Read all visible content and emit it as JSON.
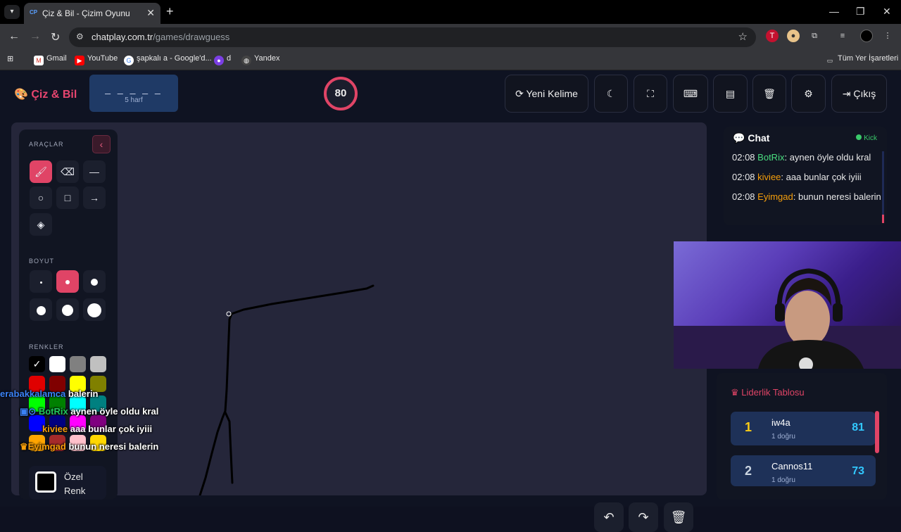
{
  "browser": {
    "tab_title": "Çiz & Bil - Çizim Oyunu",
    "favicon": "CP",
    "url_host": "chatplay.com.tr",
    "url_path": "/games/drawguess",
    "bookmarks": [
      "Gmail",
      "YouTube",
      "şapkalı a - Google'd...",
      "d",
      "Yandex"
    ],
    "all_bookmarks": "Tüm Yer İşaretleri"
  },
  "header": {
    "logo": "Çiz & Bil",
    "word_blanks": "_ _ _ _ _",
    "word_hint": "5 harf",
    "timer": "80",
    "new_word": "Yeni Kelime",
    "exit": "Çıkış"
  },
  "tools": {
    "section_tools": "ARAÇLAR",
    "section_size": "BOYUT",
    "section_colors": "RENKLER",
    "custom_color": "Özel Renk",
    "colors": [
      "#000000",
      "#ffffff",
      "#808080",
      "#c0c0c0",
      "#e00000",
      "#800000",
      "#ffff00",
      "#808000",
      "#00ff00",
      "#008000",
      "#00ffff",
      "#008080",
      "#0000ff",
      "#000080",
      "#ff00ff",
      "#800080",
      "#ffa500",
      "#a52a2a",
      "#ffc0cb",
      "#ffd700"
    ]
  },
  "overlay_chat": [
    {
      "user": "erabakkalamca",
      "text": "balerin",
      "color": "#3b82f6"
    },
    {
      "user": "BotRix",
      "text": "aynen öyle oldu kral",
      "color": "#22c55e"
    },
    {
      "user": "kiviee",
      "text": "aaa bunlar çok iyiii",
      "color": "#f59e0b"
    },
    {
      "user": "Eyimgad",
      "text": "bunun neresi balerin",
      "color": "#f59e0b"
    }
  ],
  "chat": {
    "title": "Chat",
    "platform": "Kick",
    "messages": [
      {
        "time": "02:08",
        "user": "BotRix",
        "text": ": aynen öyle oldu kral",
        "color": "#4ade80"
      },
      {
        "time": "02:08",
        "user": "kiviee",
        "text": ": aaa bunlar çok iyiii",
        "color": "#f59e0b"
      },
      {
        "time": "02:08",
        "user": "Eyimgad",
        "text": ": bunun neresi balerin",
        "color": "#f59e0b"
      }
    ]
  },
  "leaderboard": {
    "title": "Liderlik Tablosu",
    "rows": [
      {
        "rank": "1",
        "name": "iw4a",
        "sub": "1 doğru",
        "score": "81",
        "rank_color": "#facc15"
      },
      {
        "rank": "2",
        "name": "Cannos11",
        "sub": "1 doğru",
        "score": "73",
        "rank_color": "#cbd5e1"
      }
    ]
  }
}
